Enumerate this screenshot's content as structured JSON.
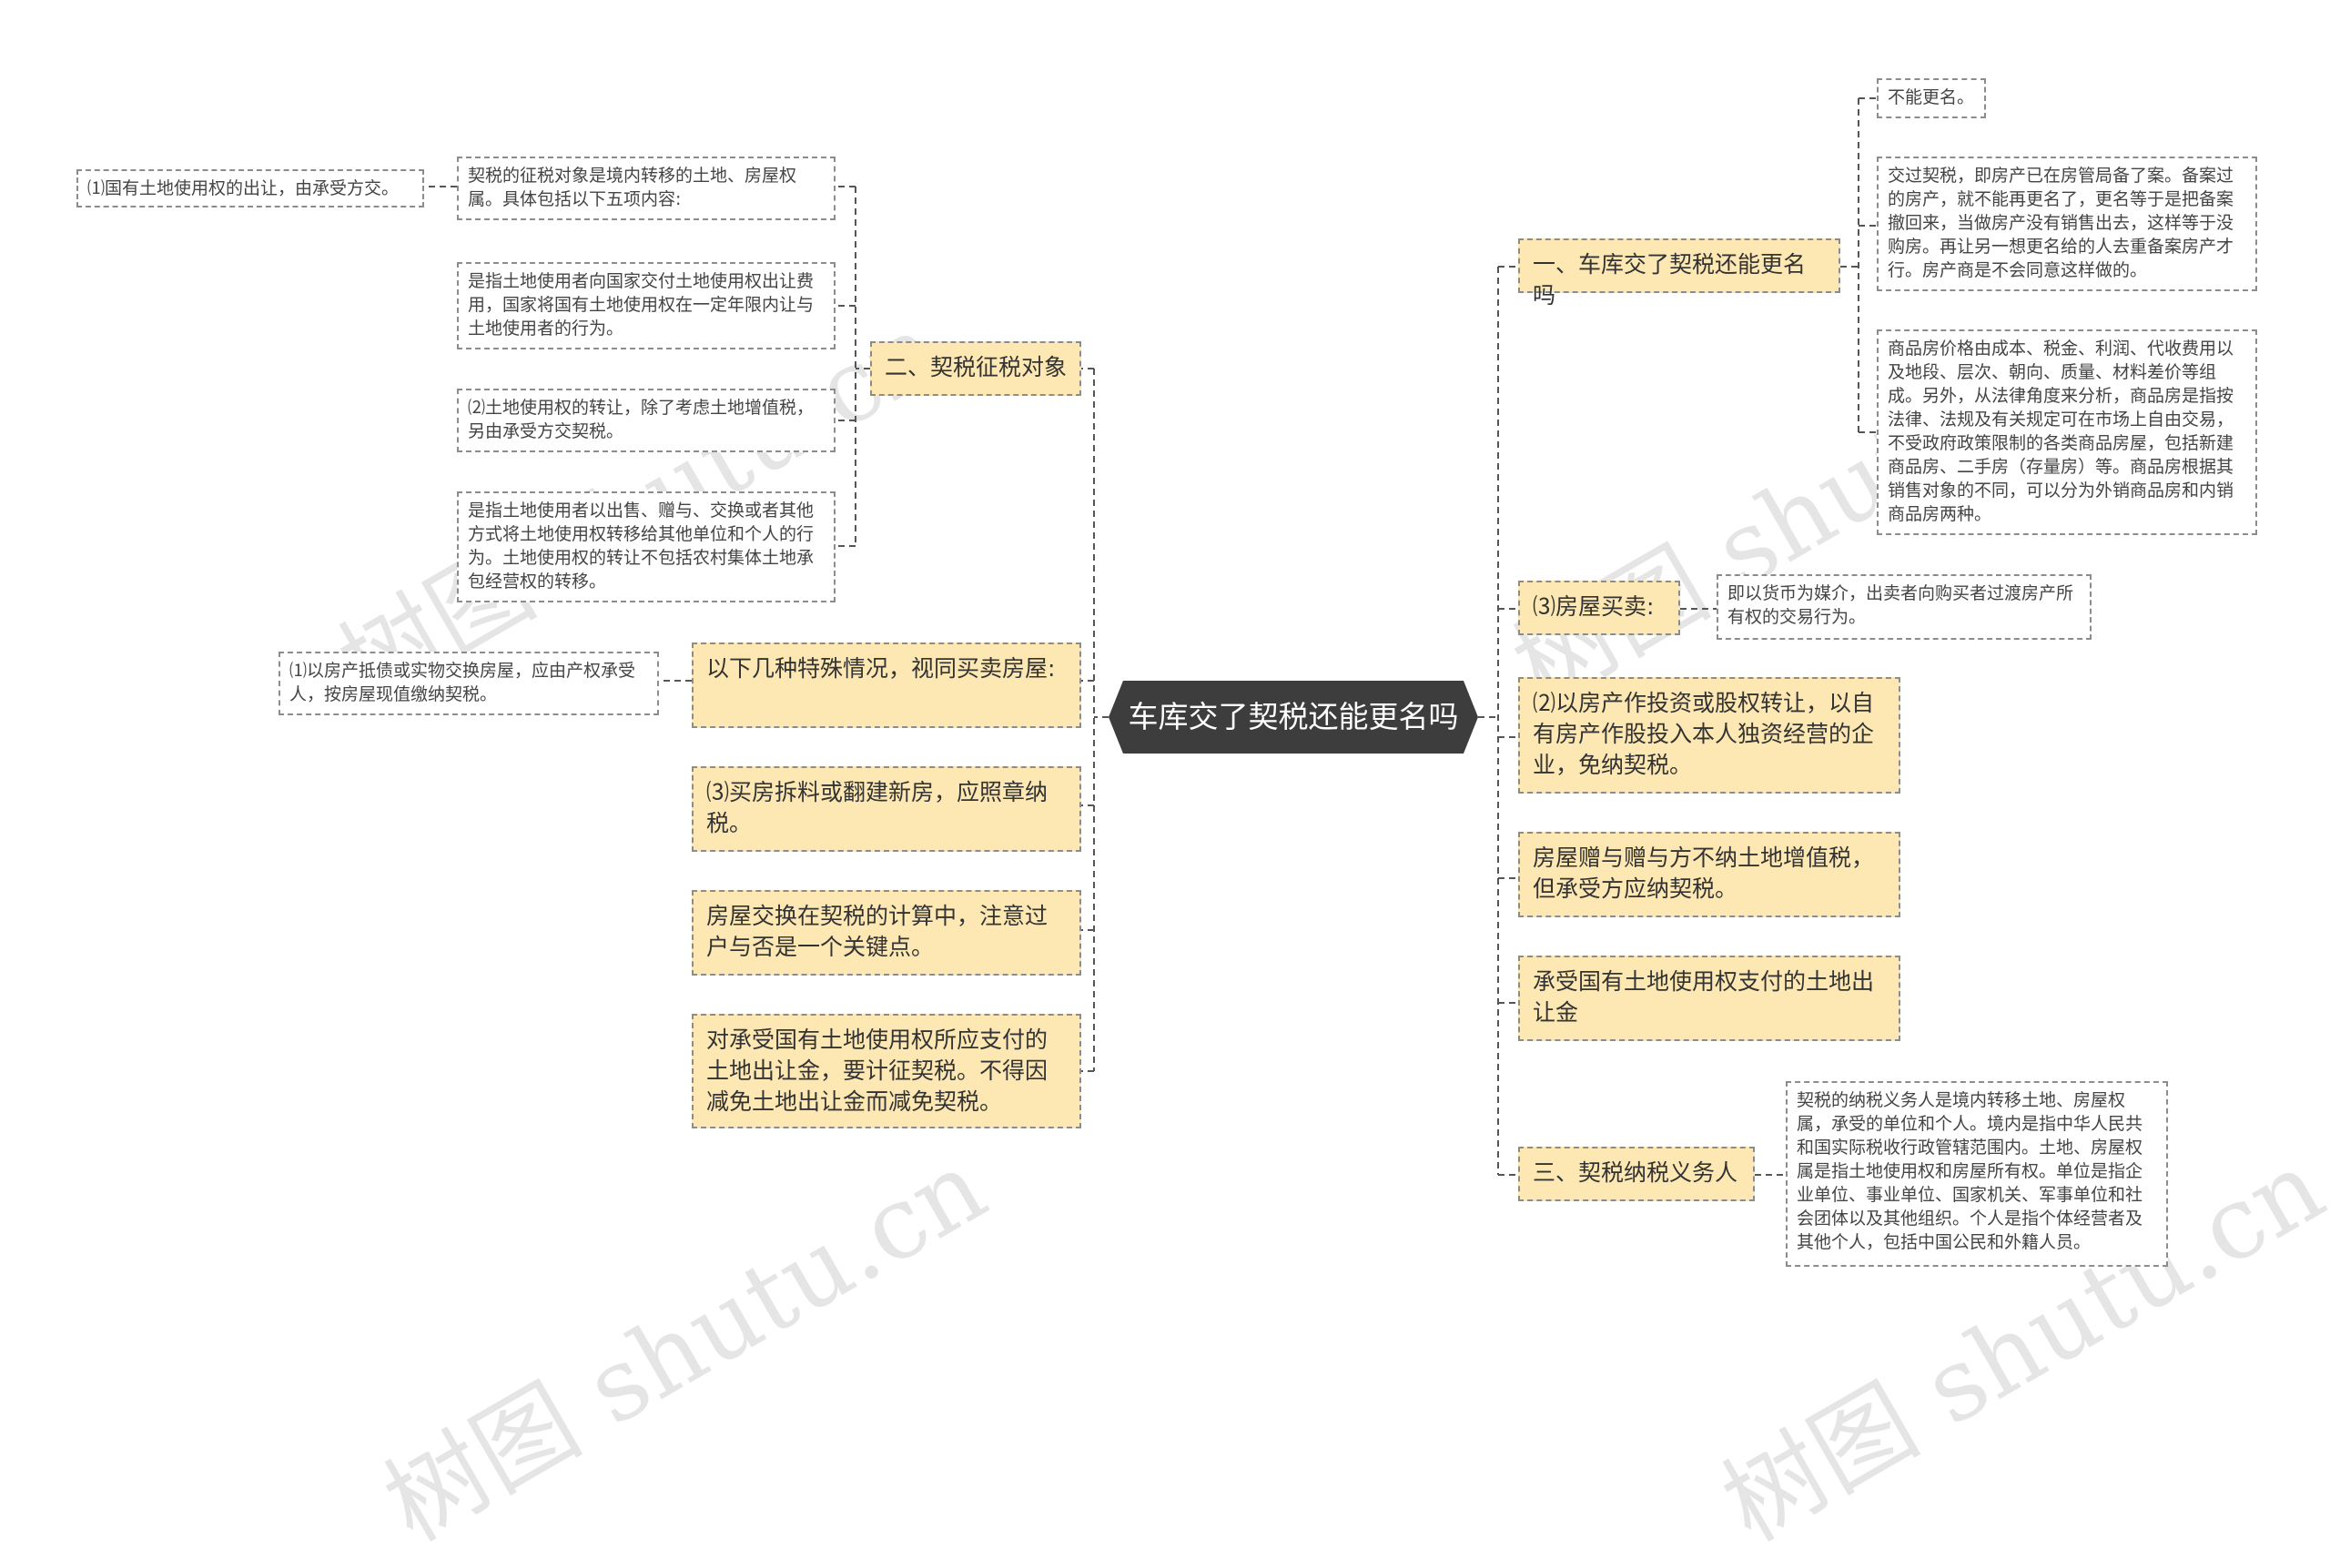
{
  "root": {
    "label": "车库交了契税还能更名吗"
  },
  "watermark": {
    "text": "树图 shutu.cn"
  },
  "left": {
    "topic_object": {
      "label": "二、契税征税对象",
      "children": [
        "契税的征税对象是境内转移的土地、房屋权属。具体包括以下五项内容:",
        "是指土地使用者向国家交付土地使用权出让费用，国家将国有土地使用权在一定年限内让与土地使用者的行为。",
        "⑵土地使用权的转让，除了考虑土地增值税，另由承受方交契税。",
        "是指土地使用者以出售、赠与、交换或者其他方式将土地使用权转移给其他单位和个人的行为。土地使用权的转让不包括农村集体土地承包经营权的转移。"
      ],
      "grandchild": "⑴国有土地使用权的出让，由承受方交。"
    },
    "topic_special": {
      "label": "以下几种特殊情况，视同买卖房屋:",
      "child": "⑴以房产抵债或实物交换房屋，应由产权承受人，按房屋现值缴纳契税。"
    },
    "topic_demolish": {
      "label": "⑶买房拆料或翻建新房，应照章纳税。"
    },
    "topic_exchange": {
      "label": "房屋交换在契税的计算中，注意过户与否是一个关键点。"
    },
    "topic_land_fee": {
      "label": "对承受国有土地使用权所应支付的土地出让金，要计征契税。不得因减免土地出让金而减免契税。"
    }
  },
  "right": {
    "topic_rename": {
      "label": "一、车库交了契税还能更名吗",
      "children": [
        "不能更名。",
        "交过契税，即房产已在房管局备了案。备案过的房产，就不能再更名了，更名等于是把备案撤回来，当做房产没有销售出去，这样等于没购房。再让另一想更名给的人去重备案房产才行。房产商是不会同意这样做的。",
        "商品房价格由成本、税金、利润、代收费用以及地段、层次、朝向、质量、材料差价等组成。另外，从法律角度来分析，商品房是指按法律、法规及有关规定可在市场上自由交易，不受政府政策限制的各类商品房屋，包括新建商品房、二手房（存量房）等。商品房根据其销售对象的不同，可以分为外销商品房和内销商品房两种。"
      ]
    },
    "topic_trade": {
      "label": "⑶房屋买卖:",
      "child": "即以货币为媒介，出卖者向购买者过渡房产所有权的交易行为。"
    },
    "topic_invest": {
      "label": "⑵以房产作投资或股权转让，以自有房产作股投入本人独资经营的企业，免纳契税。"
    },
    "topic_gift": {
      "label": "房屋赠与赠与方不纳土地增值税，但承受方应纳契税。"
    },
    "topic_land_payment": {
      "label": "承受国有土地使用权支付的土地出让金"
    },
    "topic_taxpayer": {
      "label": "三、契税纳税义务人",
      "child": "契税的纳税义务人是境内转移土地、房屋权属，承受的单位和个人。境内是指中华人民共和国实际税收行政管辖范围内。土地、房屋权属是指土地使用权和房屋所有权。单位是指企业单位、事业单位、国家机关、军事单位和社会团体以及其他组织。个人是指个体经营者及其他个人，包括中国公民和外籍人员。"
    }
  }
}
